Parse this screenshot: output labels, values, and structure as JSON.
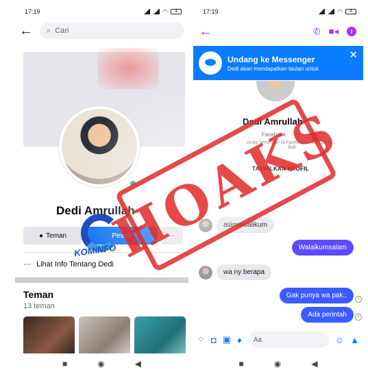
{
  "left_phone": {
    "status": {
      "time": "17:19",
      "battery": "4"
    },
    "search": {
      "placeholder": "Cari"
    },
    "profile": {
      "name": "Dedi Amrullah"
    },
    "buttons": {
      "friend": "Teman",
      "message": "Pesan",
      "more": "···"
    },
    "info_link": "Lihat Info Tentang Dedi",
    "friends": {
      "title": "Teman",
      "count": "13 teman"
    }
  },
  "right_phone": {
    "status": {
      "time": "17:19",
      "battery": "4"
    },
    "invite": {
      "title": "Undang ke Messenger",
      "subtitle": "Dedi akan mendapatkan tautan untuk",
      "close": "✕"
    },
    "profile": {
      "name": "Dedi Amrullah",
      "sub1": "Facebook",
      "sub2": "Anda berteman di Facebook · Tinggal di ... Bali",
      "view_profile": "TAMPILKAN PROFIL"
    },
    "messages": [
      {
        "from": "them",
        "text": "asimmualikum"
      },
      {
        "from": "me",
        "text": "Walaikumsalam"
      },
      {
        "from": "them",
        "text": "wa ny berapa"
      },
      {
        "from": "me",
        "text": "Gak punya wa pak.."
      },
      {
        "from": "me",
        "text": "Ada perintah"
      }
    ],
    "composer": {
      "placeholder": "Aa"
    }
  },
  "stamp": {
    "text": "HOAKS",
    "logo_text": "KOMINFO"
  },
  "colors": {
    "stamp_red": "#e12a2a",
    "messenger_blue": "#0a7cff",
    "messenger_purple": "#a033ff",
    "facebook_blue": "#1877f2"
  }
}
